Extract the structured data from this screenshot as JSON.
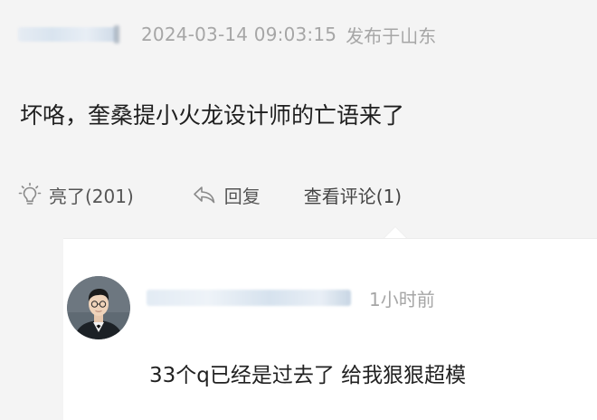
{
  "post": {
    "author_name_display": "",
    "timestamp": "2024-03-14 09:03:15",
    "location": "发布于山东",
    "content": "坏咯，奎桑提小火龙设计师的亡语来了"
  },
  "actions": {
    "like": {
      "label": "亮了(201)",
      "icon": "lightbulb-icon"
    },
    "reply": {
      "label": "回复",
      "icon": "reply-arrow-icon"
    },
    "view_comments": {
      "label": "查看评论(1)"
    }
  },
  "comment": {
    "author_name_display": "",
    "time": "1小时前",
    "text": "33个q已经是过去了 给我狠狠超模",
    "avatar_icon": "user-avatar-photo"
  },
  "colors": {
    "background": "#f4f4f4",
    "panel": "#ffffff",
    "muted_text": "#a6a6a6",
    "body_text": "#1f1f1f"
  }
}
